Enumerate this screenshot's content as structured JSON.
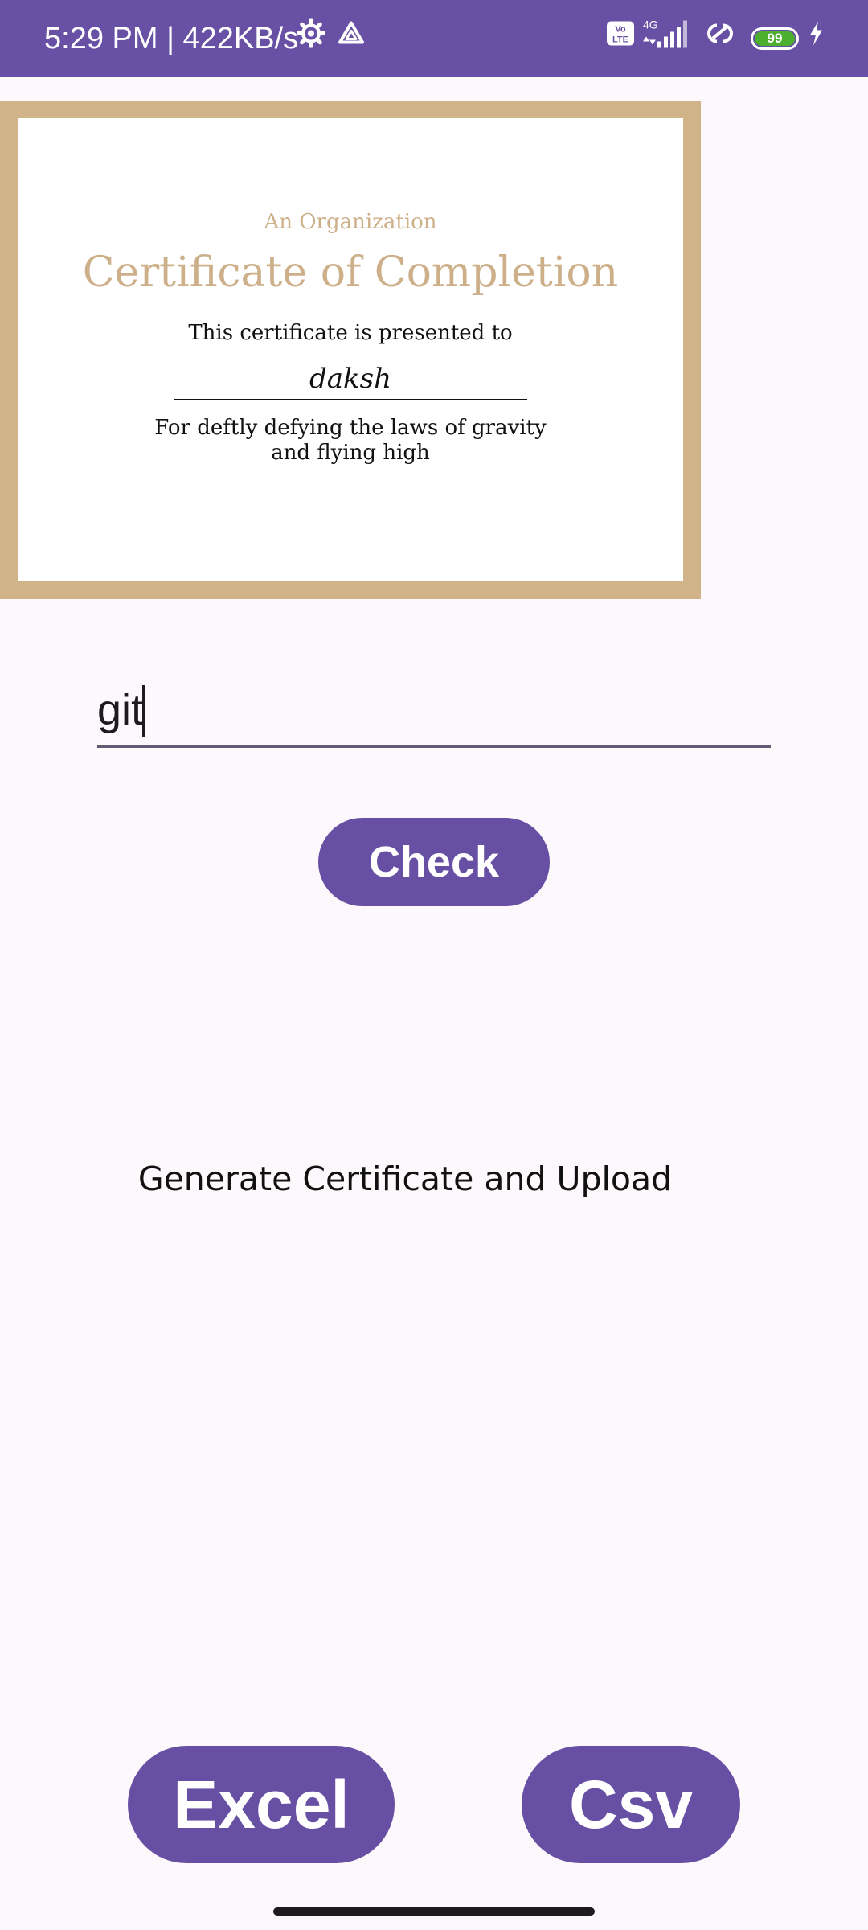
{
  "status_bar": {
    "time_speed": "5:29 PM | 422KB/s",
    "network_label": "4G",
    "volte_label": "Vo LTE",
    "battery_level": "99",
    "icons": [
      "settings-icon",
      "drive-icon",
      "volte-icon",
      "signal-icon",
      "link-icon",
      "battery-icon",
      "charging-icon"
    ]
  },
  "certificate": {
    "organization": "An Organization",
    "title": "Certificate of Completion",
    "presented_to": "This certificate is presented to",
    "recipient": "daksh",
    "reason_line1": "For deftly defying the laws of gravity",
    "reason_line2": "and flying high",
    "border_color": "#d1b389",
    "accent_color": "#cdb08a"
  },
  "name_input": {
    "value": "git"
  },
  "buttons": {
    "check_label": "Check",
    "excel_label": "Excel",
    "csv_label": "Csv"
  },
  "generate_label": "Generate Certificate and Upload",
  "colors": {
    "primary": "#6750a4",
    "background": "#fdf8fb"
  }
}
